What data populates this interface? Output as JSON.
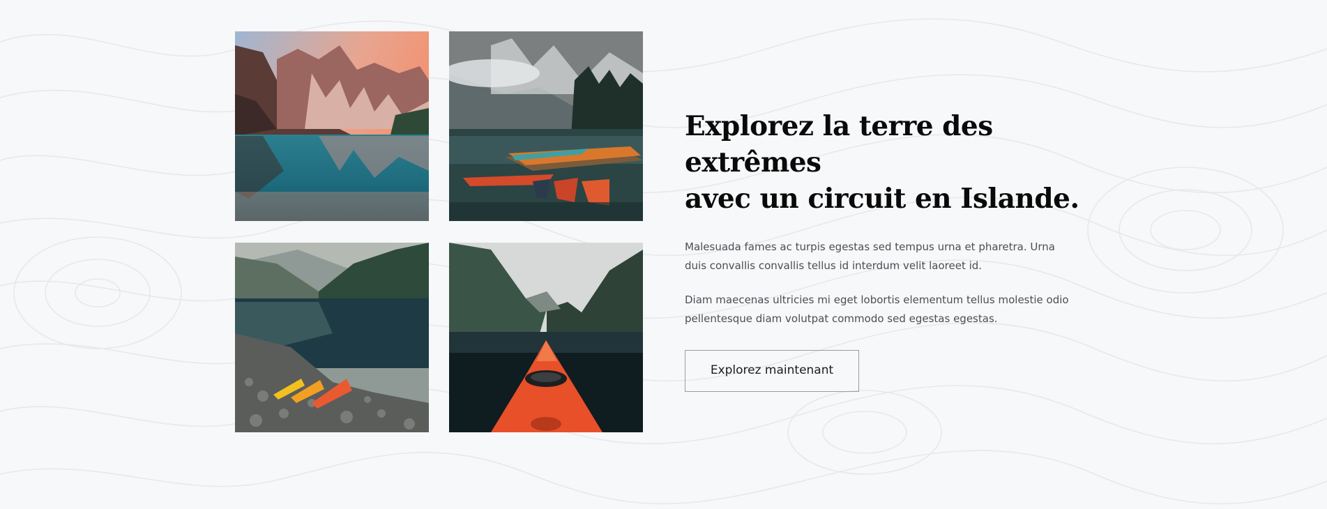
{
  "hero": {
    "title_line1": "Explorez la terre des extrêmes",
    "title_line2": "avec un circuit en Islande.",
    "paragraph1": "Malesuada fames ac turpis egestas sed tempus urna et pharetra. Urna duis convallis convallis tellus id interdum velit laoreet id.",
    "paragraph2": "Diam maecenas ultricies mi eget lobortis elementum tellus molestie odio pellentesque diam volutpat commodo sed egestas egestas.",
    "cta_label": "Explorez maintenant"
  },
  "colors": {
    "background": "#f7f8f9",
    "title": "#0a0a0a",
    "body_text": "#4b4e54",
    "button_border": "#9a9ca1",
    "accent_kayak": "#e8502a"
  },
  "gallery": {
    "images": [
      {
        "subject": "mountain-lake-sunset"
      },
      {
        "subject": "lake-with-canoes"
      },
      {
        "subject": "fjord-with-kayaks-on-shore"
      },
      {
        "subject": "kayak-bow-in-fjord"
      }
    ]
  }
}
